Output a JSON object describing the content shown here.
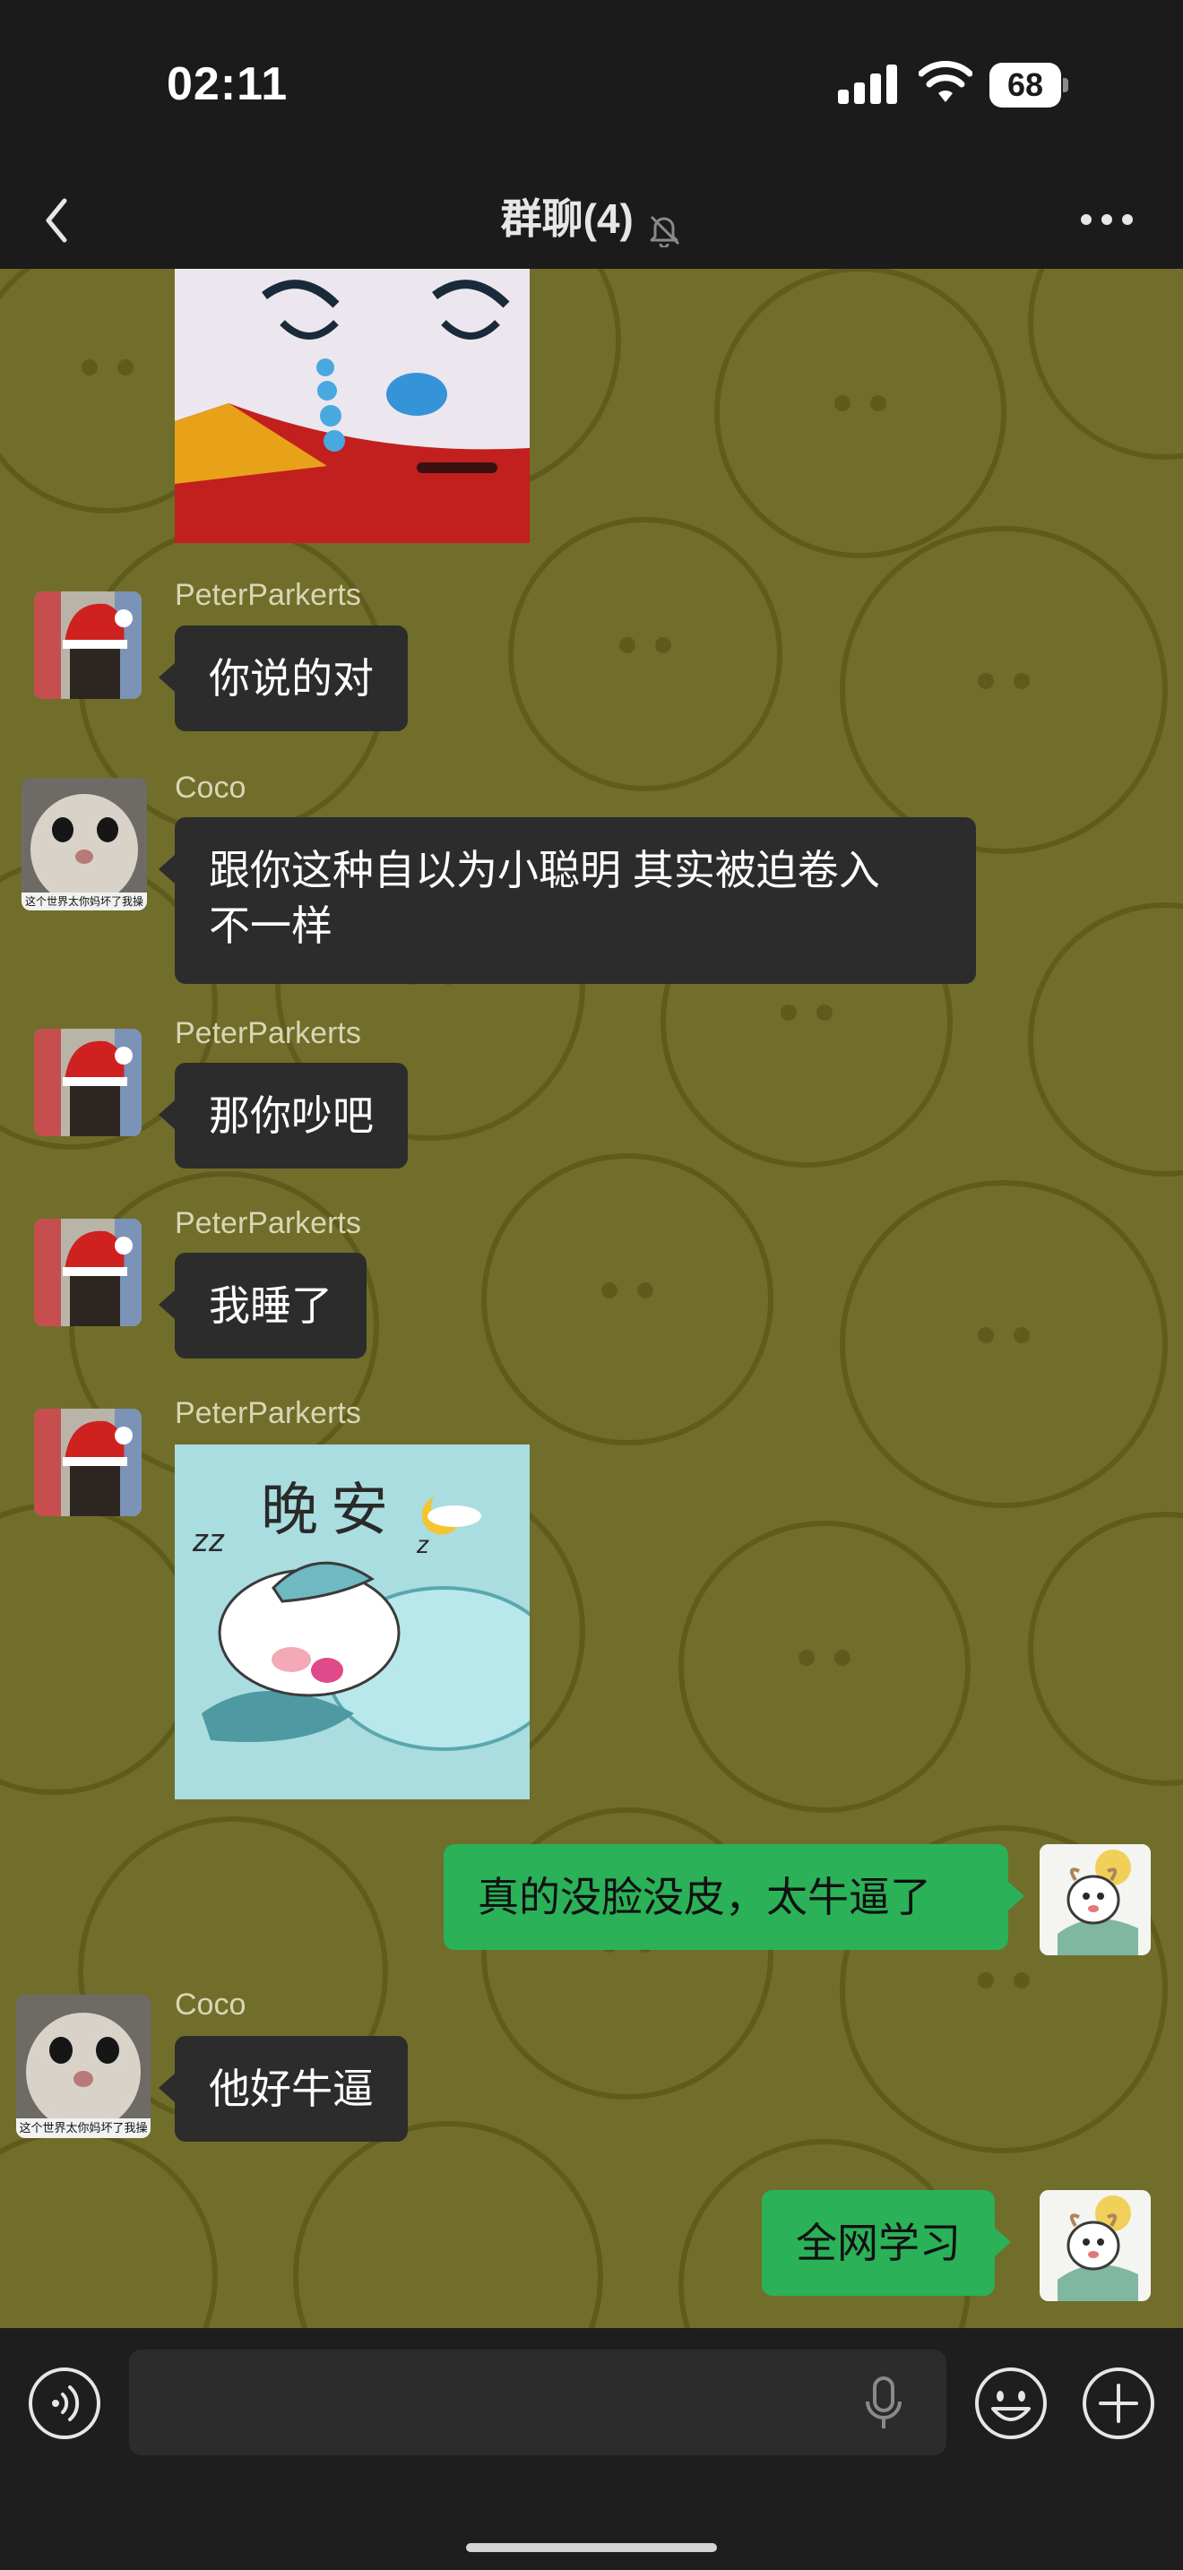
{
  "status_bar": {
    "time": "02:11",
    "battery": "68",
    "icons": [
      "signal-icon",
      "wifi-icon",
      "battery-icon"
    ]
  },
  "nav": {
    "back_icon": "chevron-left-icon",
    "title": "群聊(4)",
    "mute_icon": "bell-slash-icon",
    "more_icon": "more-icon"
  },
  "messages": [
    {
      "type": "sticker",
      "direction": "in",
      "description": "crying cartoon face sticker (partially scrolled)"
    },
    {
      "type": "text",
      "direction": "in",
      "sender": "PeterParkerts",
      "text": "你说的对"
    },
    {
      "type": "text",
      "direction": "in",
      "sender": "Coco",
      "text_line1": "跟你这种自以为小聪明 其实被迫卷入",
      "text_line2": "不一样"
    },
    {
      "type": "text",
      "direction": "in",
      "sender": "PeterParkerts",
      "text": "那你吵吧"
    },
    {
      "type": "text",
      "direction": "in",
      "sender": "PeterParkerts",
      "text": "我睡了"
    },
    {
      "type": "sticker",
      "direction": "in",
      "sender": "PeterParkerts",
      "sticker_text": "晚安",
      "zz": "zz",
      "z": "z"
    },
    {
      "type": "text",
      "direction": "out",
      "text": "真的没脸没皮，太牛逼了"
    },
    {
      "type": "text",
      "direction": "in",
      "sender": "Coco",
      "text": "他好牛逼"
    },
    {
      "type": "text",
      "direction": "out",
      "text": "全网学习"
    }
  ],
  "avatars": {
    "coco_caption": "这个世界太你妈坏了我操"
  },
  "input_bar": {
    "voice_icon": "voice-icon",
    "input_value": "",
    "mic_icon": "mic-icon",
    "emoji_icon": "emoji-icon",
    "plus_icon": "plus-icon"
  },
  "colors": {
    "chat_background": "#716d2a",
    "incoming_bubble": "#2c2c2c",
    "outgoing_bubble": "#2bb158",
    "bars": "#1b1b1b"
  }
}
